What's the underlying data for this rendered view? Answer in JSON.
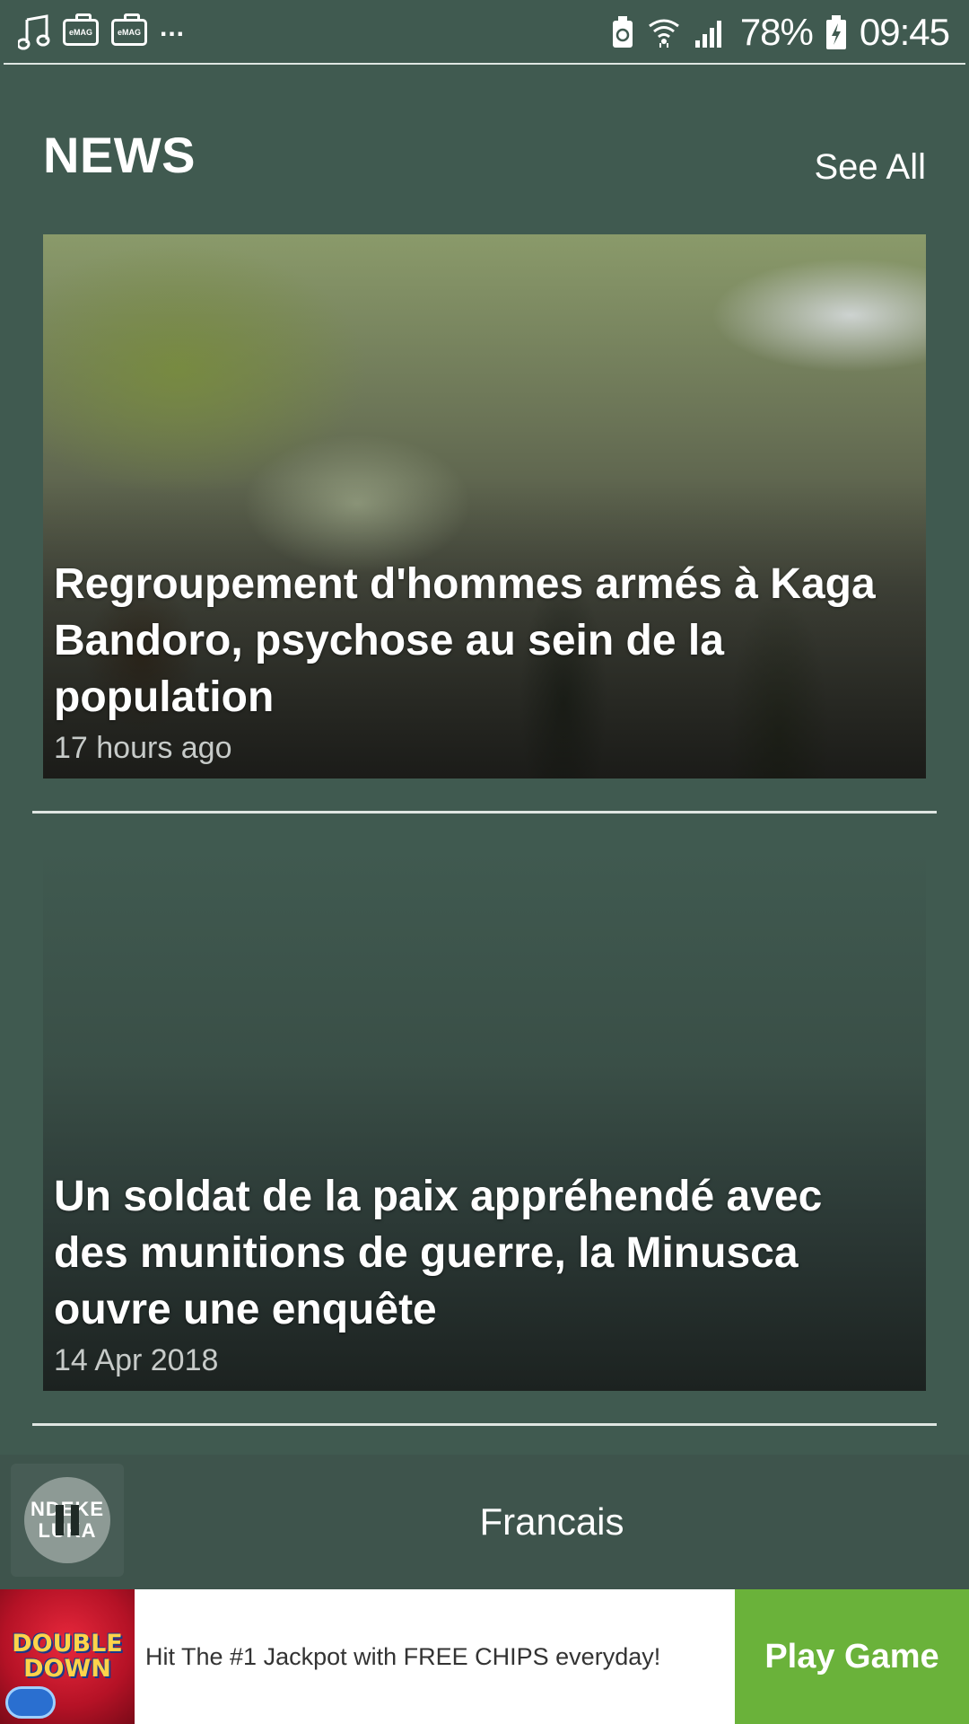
{
  "status_bar": {
    "battery_percent": "78%",
    "time": "09:45",
    "notification_more": "...",
    "emag_label": "eMAG"
  },
  "news": {
    "title": "NEWS",
    "see_all_label": "See All",
    "articles": [
      {
        "headline": "Regroupement d'hommes armés à Kaga Bandoro, psychose au sein de la population",
        "time": "17 hours ago"
      },
      {
        "headline": "Un soldat de la paix appréhendé avec des munitions de guerre, la Minusca ouvre une enquête",
        "time": "14 Apr 2018"
      }
    ]
  },
  "player": {
    "station_logo_line1": "NDEKE",
    "station_logo_line2": "LUKA",
    "language": "Francais"
  },
  "ad": {
    "logo_line1": "DOUBLE",
    "logo_line2": "DOWN",
    "text": "Hit The #1 Jackpot with FREE CHIPS everyday!",
    "cta_label": "Play Game",
    "cta_color": "#6ab23a"
  }
}
